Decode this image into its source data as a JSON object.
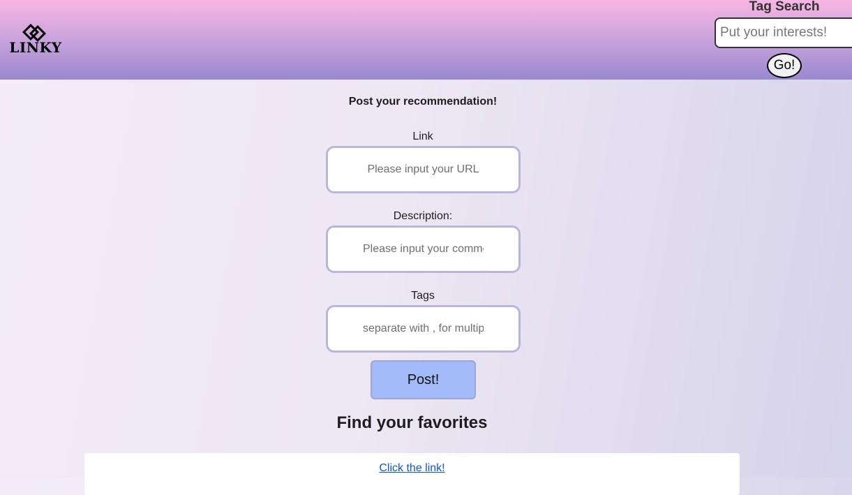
{
  "header": {
    "logo_text": "LINKY",
    "tag_search": {
      "title": "Tag Search",
      "placeholder": "Put your interests!",
      "go_label": "Go!"
    }
  },
  "form": {
    "title": "Post your recommendation!",
    "link": {
      "label": "Link",
      "placeholder": "Please input your URL"
    },
    "description": {
      "label": "Description:",
      "placeholder": "Please input your comment"
    },
    "tags": {
      "label": "Tags",
      "placeholder": "separate with , for multiple tags"
    },
    "post_label": "Post!"
  },
  "favorites": {
    "title": "Find your favorites",
    "first_card_link": "Click the link!"
  },
  "colors": {
    "header_top": "#f8b6e3",
    "header_bottom": "#9a88cf",
    "post_button": "#a2bbf8",
    "link": "#0b57d0"
  }
}
